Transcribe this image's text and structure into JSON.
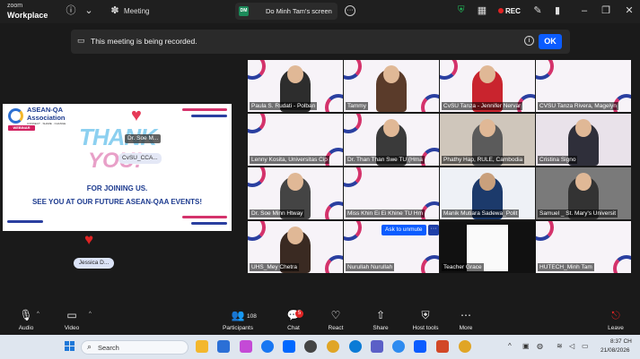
{
  "window": {
    "logo_top": "zoom",
    "logo_bottom": "Workplace",
    "meeting_label": "Meeting",
    "share_avatar": "DM",
    "share_label": "Do Minh Tam's screen",
    "rec_label": "REC"
  },
  "banner": {
    "text": "This meeting is being recorded.",
    "ok_label": "OK"
  },
  "slide": {
    "org_title_line1": "ASEAN-QA",
    "org_title_line2": "Association",
    "org_sub": "CONNECT · SHARE · CHANGE",
    "webinar_tag": "WEBINAR",
    "thank_text": "THANK",
    "you_text": "YOU!",
    "line1": "FOR JOINING US.",
    "line2": "SEE YOU AT OUR FUTURE ASEAN-QAA EVENTS!",
    "tag_soe": "Dr. Soe M...",
    "tag_cvsu": "CvSU_CCA..."
  },
  "reaction_tag": "Jessica D...",
  "participants": [
    {
      "name": "Paula S. Rudati - Polban"
    },
    {
      "name": "Tammy"
    },
    {
      "name": "CvSU Tanza - Jennifer Nervar"
    },
    {
      "name": "CVSU Tanza Rivera, Magelyn"
    },
    {
      "name": "Lenny Kosita, Universitas Cip"
    },
    {
      "name": "Dr. Than Than Swe TU (Hma"
    },
    {
      "name": "Phathy Hap, RULE, Cambodia"
    },
    {
      "name": "Cristina Signo"
    },
    {
      "name": "Dr. Soe Minn Htway"
    },
    {
      "name": "Miss Khin Ei Ei Khine TU Hm"
    },
    {
      "name": "Manik Mutiara Sadewa_Polit"
    },
    {
      "name": "Samuel _ St. Mary's Universit"
    },
    {
      "name": "UHS_Mey Chetra"
    },
    {
      "name": "Nurullah Nurullah"
    },
    {
      "name": "Teacher Grace"
    },
    {
      "name": "HUTECH_Minh Tam"
    }
  ],
  "unmute_tip": "Ask to unmute",
  "toolbar": {
    "audio": "Audio",
    "video": "Video",
    "participants": "Participants",
    "participants_count": "108",
    "chat": "Chat",
    "chat_badge": "5",
    "react": "React",
    "share": "Share",
    "host_tools": "Host tools",
    "more": "More",
    "leave": "Leave"
  },
  "taskbar": {
    "search_placeholder": "Search",
    "time": "8:37 CH",
    "date": "21/08/2026"
  }
}
